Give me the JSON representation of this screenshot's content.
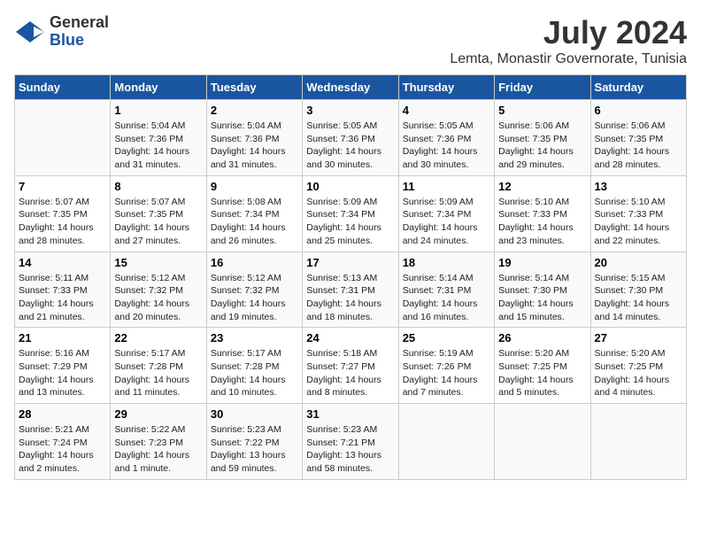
{
  "header": {
    "logo_general": "General",
    "logo_blue": "Blue",
    "title": "July 2024",
    "subtitle": "Lemta, Monastir Governorate, Tunisia"
  },
  "calendar": {
    "days_of_week": [
      "Sunday",
      "Monday",
      "Tuesday",
      "Wednesday",
      "Thursday",
      "Friday",
      "Saturday"
    ],
    "weeks": [
      [
        {
          "day": "",
          "detail": ""
        },
        {
          "day": "1",
          "detail": "Sunrise: 5:04 AM\nSunset: 7:36 PM\nDaylight: 14 hours\nand 31 minutes."
        },
        {
          "day": "2",
          "detail": "Sunrise: 5:04 AM\nSunset: 7:36 PM\nDaylight: 14 hours\nand 31 minutes."
        },
        {
          "day": "3",
          "detail": "Sunrise: 5:05 AM\nSunset: 7:36 PM\nDaylight: 14 hours\nand 30 minutes."
        },
        {
          "day": "4",
          "detail": "Sunrise: 5:05 AM\nSunset: 7:36 PM\nDaylight: 14 hours\nand 30 minutes."
        },
        {
          "day": "5",
          "detail": "Sunrise: 5:06 AM\nSunset: 7:35 PM\nDaylight: 14 hours\nand 29 minutes."
        },
        {
          "day": "6",
          "detail": "Sunrise: 5:06 AM\nSunset: 7:35 PM\nDaylight: 14 hours\nand 28 minutes."
        }
      ],
      [
        {
          "day": "7",
          "detail": "Sunrise: 5:07 AM\nSunset: 7:35 PM\nDaylight: 14 hours\nand 28 minutes."
        },
        {
          "day": "8",
          "detail": "Sunrise: 5:07 AM\nSunset: 7:35 PM\nDaylight: 14 hours\nand 27 minutes."
        },
        {
          "day": "9",
          "detail": "Sunrise: 5:08 AM\nSunset: 7:34 PM\nDaylight: 14 hours\nand 26 minutes."
        },
        {
          "day": "10",
          "detail": "Sunrise: 5:09 AM\nSunset: 7:34 PM\nDaylight: 14 hours\nand 25 minutes."
        },
        {
          "day": "11",
          "detail": "Sunrise: 5:09 AM\nSunset: 7:34 PM\nDaylight: 14 hours\nand 24 minutes."
        },
        {
          "day": "12",
          "detail": "Sunrise: 5:10 AM\nSunset: 7:33 PM\nDaylight: 14 hours\nand 23 minutes."
        },
        {
          "day": "13",
          "detail": "Sunrise: 5:10 AM\nSunset: 7:33 PM\nDaylight: 14 hours\nand 22 minutes."
        }
      ],
      [
        {
          "day": "14",
          "detail": "Sunrise: 5:11 AM\nSunset: 7:33 PM\nDaylight: 14 hours\nand 21 minutes."
        },
        {
          "day": "15",
          "detail": "Sunrise: 5:12 AM\nSunset: 7:32 PM\nDaylight: 14 hours\nand 20 minutes."
        },
        {
          "day": "16",
          "detail": "Sunrise: 5:12 AM\nSunset: 7:32 PM\nDaylight: 14 hours\nand 19 minutes."
        },
        {
          "day": "17",
          "detail": "Sunrise: 5:13 AM\nSunset: 7:31 PM\nDaylight: 14 hours\nand 18 minutes."
        },
        {
          "day": "18",
          "detail": "Sunrise: 5:14 AM\nSunset: 7:31 PM\nDaylight: 14 hours\nand 16 minutes."
        },
        {
          "day": "19",
          "detail": "Sunrise: 5:14 AM\nSunset: 7:30 PM\nDaylight: 14 hours\nand 15 minutes."
        },
        {
          "day": "20",
          "detail": "Sunrise: 5:15 AM\nSunset: 7:30 PM\nDaylight: 14 hours\nand 14 minutes."
        }
      ],
      [
        {
          "day": "21",
          "detail": "Sunrise: 5:16 AM\nSunset: 7:29 PM\nDaylight: 14 hours\nand 13 minutes."
        },
        {
          "day": "22",
          "detail": "Sunrise: 5:17 AM\nSunset: 7:28 PM\nDaylight: 14 hours\nand 11 minutes."
        },
        {
          "day": "23",
          "detail": "Sunrise: 5:17 AM\nSunset: 7:28 PM\nDaylight: 14 hours\nand 10 minutes."
        },
        {
          "day": "24",
          "detail": "Sunrise: 5:18 AM\nSunset: 7:27 PM\nDaylight: 14 hours\nand 8 minutes."
        },
        {
          "day": "25",
          "detail": "Sunrise: 5:19 AM\nSunset: 7:26 PM\nDaylight: 14 hours\nand 7 minutes."
        },
        {
          "day": "26",
          "detail": "Sunrise: 5:20 AM\nSunset: 7:25 PM\nDaylight: 14 hours\nand 5 minutes."
        },
        {
          "day": "27",
          "detail": "Sunrise: 5:20 AM\nSunset: 7:25 PM\nDaylight: 14 hours\nand 4 minutes."
        }
      ],
      [
        {
          "day": "28",
          "detail": "Sunrise: 5:21 AM\nSunset: 7:24 PM\nDaylight: 14 hours\nand 2 minutes."
        },
        {
          "day": "29",
          "detail": "Sunrise: 5:22 AM\nSunset: 7:23 PM\nDaylight: 14 hours\nand 1 minute."
        },
        {
          "day": "30",
          "detail": "Sunrise: 5:23 AM\nSunset: 7:22 PM\nDaylight: 13 hours\nand 59 minutes."
        },
        {
          "day": "31",
          "detail": "Sunrise: 5:23 AM\nSunset: 7:21 PM\nDaylight: 13 hours\nand 58 minutes."
        },
        {
          "day": "",
          "detail": ""
        },
        {
          "day": "",
          "detail": ""
        },
        {
          "day": "",
          "detail": ""
        }
      ]
    ]
  }
}
